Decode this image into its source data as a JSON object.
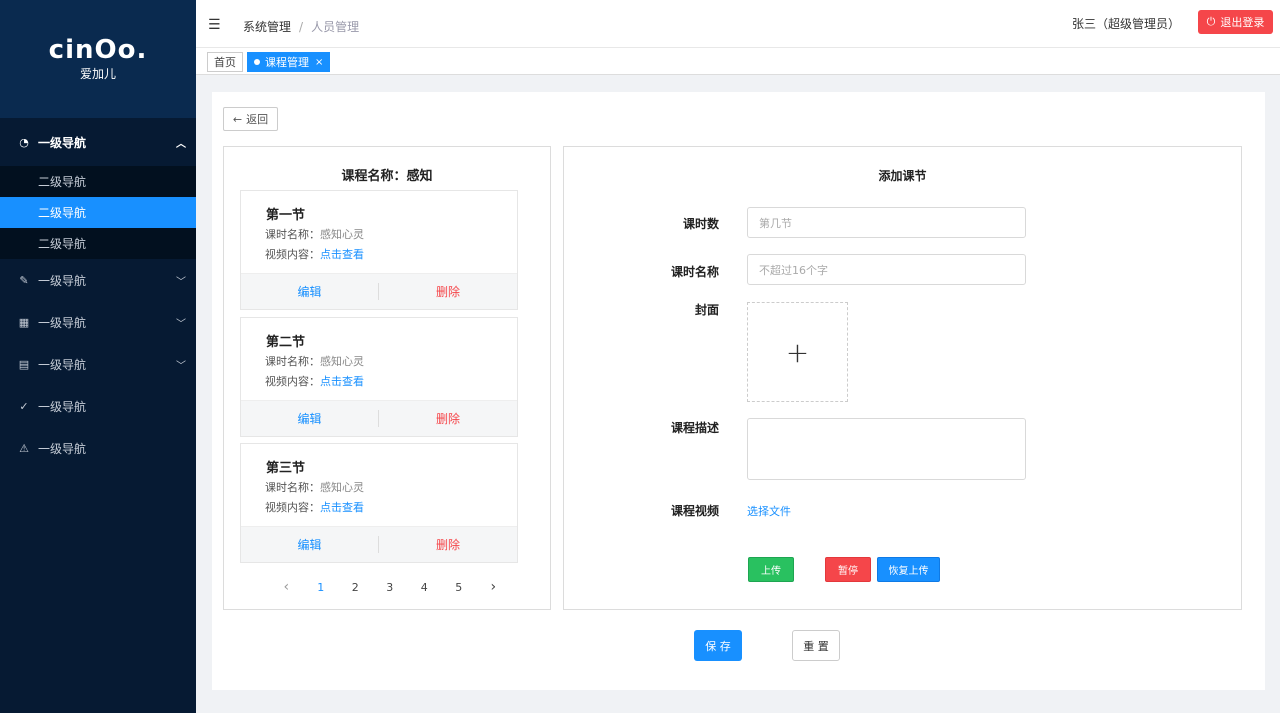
{
  "sidebar": {
    "logo_mark": "cinOo.",
    "logo_sub": "爱加儿",
    "group1": {
      "label": "一级导航",
      "icon": "dashboard-icon"
    },
    "sub_items": [
      {
        "label": "二级导航",
        "active": false
      },
      {
        "label": "二级导航",
        "active": true
      },
      {
        "label": "二级导航",
        "active": false
      }
    ],
    "items": [
      {
        "label": "一级导航",
        "icon": "edit-icon",
        "has_arrow": true
      },
      {
        "label": "一级导航",
        "icon": "table-icon",
        "has_arrow": true
      },
      {
        "label": "一级导航",
        "icon": "list-icon",
        "has_arrow": true
      },
      {
        "label": "一级导航",
        "icon": "check-circle-icon",
        "has_arrow": false
      },
      {
        "label": "一级导航",
        "icon": "warning-icon",
        "has_arrow": false
      }
    ]
  },
  "header": {
    "breadcrumb": [
      "系统管理",
      "人员管理"
    ],
    "user": "张三（超级管理员）",
    "logout": "退出登录"
  },
  "tabs": [
    {
      "label": "首页",
      "active": false
    },
    {
      "label": "课程管理",
      "active": true
    }
  ],
  "main": {
    "back": "返回",
    "left": {
      "title": "课程名称：感知",
      "lessons": [
        {
          "title": "第一节",
          "name_label": "课时名称：",
          "name_value": "感知心灵",
          "video_label": "视频内容：",
          "video_link": "点击查看",
          "edit": "编辑",
          "delete": "删除"
        },
        {
          "title": "第二节",
          "name_label": "课时名称：",
          "name_value": "感知心灵",
          "video_label": "视频内容：",
          "video_link": "点击查看",
          "edit": "编辑",
          "delete": "删除"
        },
        {
          "title": "第三节",
          "name_label": "课时名称：",
          "name_value": "感知心灵",
          "video_label": "视频内容：",
          "video_link": "点击查看",
          "edit": "编辑",
          "delete": "删除"
        }
      ],
      "pagination": {
        "pages": [
          "1",
          "2",
          "3",
          "4",
          "5"
        ],
        "current": "1",
        "prev": "‹",
        "next": "›"
      }
    },
    "right": {
      "title": "添加课节",
      "fields": {
        "hours": {
          "label": "课时数",
          "placeholder": "第几节"
        },
        "name": {
          "label": "课时名称",
          "placeholder": "不超过16个字"
        },
        "cover": {
          "label": "封面",
          "plus": "+"
        },
        "desc": {
          "label": "课程描述"
        },
        "video": {
          "label": "课程视频",
          "link": "选择文件"
        }
      },
      "upload_btn": "上传",
      "pause_btn": "暂停",
      "resume_btn": "恢复上传"
    },
    "save": "保 存",
    "reset": "重 置"
  },
  "colors": {
    "primary": "#1890ff",
    "danger": "#f5464a",
    "success": "#29c160",
    "sidebar": "#061a33"
  }
}
